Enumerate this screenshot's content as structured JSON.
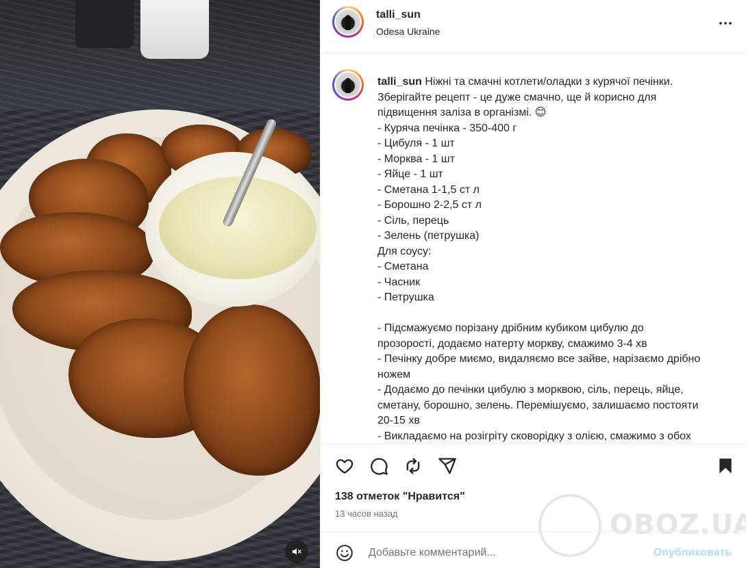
{
  "post": {
    "username": "talli_sun",
    "location": "Odesa Ukraine"
  },
  "caption": {
    "username": "talli_sun",
    "lines": [
      " Ніжні та смачні котлети/оладки з курячої печінки.",
      "Зберігайте рецепт - це дуже смачно, ще й корисно для",
      "підвищення заліза в організмі. 😊",
      "- Куряча печінка - 350-400 г",
      "- Цибуля - 1 шт",
      "- Морква - 1 шт",
      "- Яйце - 1 шт",
      "- Сметана 1-1,5 ст л",
      "- Борошно 2-2,5 ст л",
      "- Сіль, перець",
      "- Зелень (петрушка)",
      "Для соусу:",
      "- Сметана",
      "- Часник",
      "- Петрушка",
      "",
      "- Підсмажуємо порізану дрібним кубиком цибулю до",
      "прозорості, додаємо натерту моркву, смажимо 3-4 хв",
      "- Печінку добре миємо, видаляємо все зайве, нарізаємо дрібно",
      "ножем",
      "- Додаємо до печінки цибулю з морквою, сіль, перець, яйце,",
      "сметану, борошно, зелень. Перемішуємо, залишаємо постояти",
      "20-15 хв",
      "- Викладаємо на розігріту сковорідку з олією, смажимо з обох"
    ]
  },
  "stats": {
    "likes": "138 отметок \"Нравится\"",
    "time": "13 часов назад"
  },
  "comment": {
    "placeholder": "Добавьте комментарий...",
    "post_label": "Опубликовать"
  },
  "watermark": {
    "text": "OBOZ.UA"
  },
  "icons": {
    "like": "heart-icon",
    "comment": "comment-icon",
    "repost": "repost-icon",
    "share": "share-icon",
    "save": "bookmark-icon",
    "more": "more-icon",
    "emoji": "emoji-icon",
    "mute": "mute-icon"
  },
  "colors": {
    "post_button": "#b3dbff",
    "secondary_text": "#737373"
  }
}
